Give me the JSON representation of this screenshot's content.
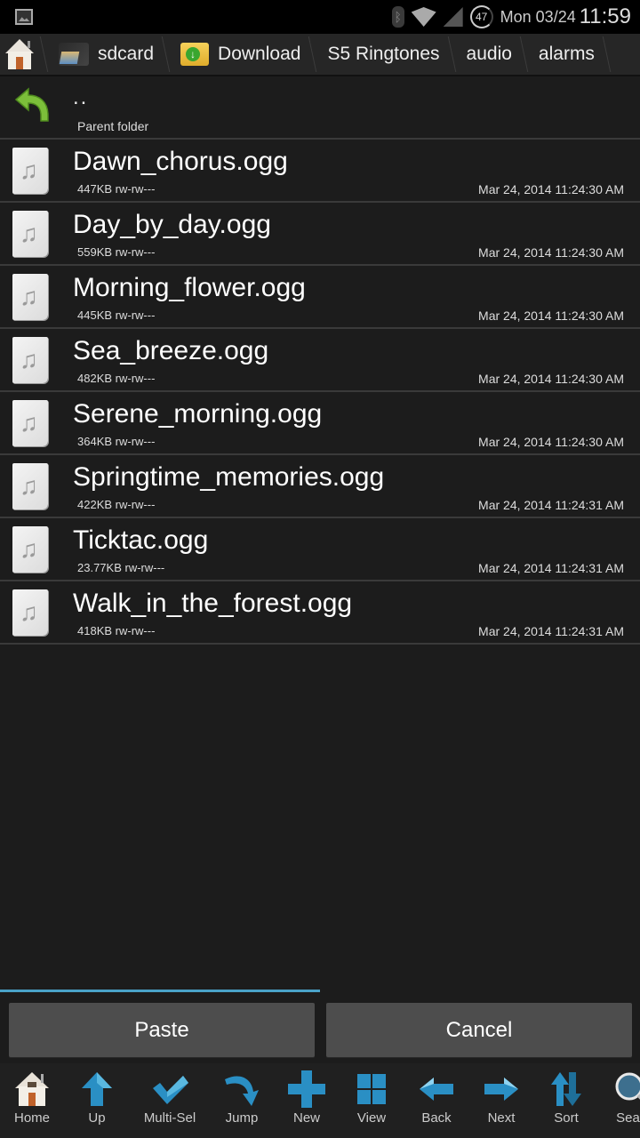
{
  "status_bar": {
    "battery": "47",
    "date": "Mon 03/24",
    "time": "11:59"
  },
  "breadcrumb": {
    "items": [
      {
        "label": "sdcard",
        "icon": "sdcard-folder-icon"
      },
      {
        "label": "Download",
        "icon": "download-folder-icon"
      },
      {
        "label": "S5 Ringtones"
      },
      {
        "label": "audio"
      },
      {
        "label": "alarms"
      }
    ]
  },
  "parent": {
    "dots": "..",
    "label": "Parent folder"
  },
  "files": [
    {
      "name": "Dawn_chorus.ogg",
      "meta": "447KB rw-rw---",
      "date": "Mar 24, 2014 11:24:30 AM"
    },
    {
      "name": "Day_by_day.ogg",
      "meta": "559KB rw-rw---",
      "date": "Mar 24, 2014 11:24:30 AM"
    },
    {
      "name": "Morning_flower.ogg",
      "meta": "445KB rw-rw---",
      "date": "Mar 24, 2014 11:24:30 AM"
    },
    {
      "name": "Sea_breeze.ogg",
      "meta": "482KB rw-rw---",
      "date": "Mar 24, 2014 11:24:30 AM"
    },
    {
      "name": "Serene_morning.ogg",
      "meta": "364KB rw-rw---",
      "date": "Mar 24, 2014 11:24:30 AM"
    },
    {
      "name": "Springtime_memories.ogg",
      "meta": "422KB rw-rw---",
      "date": "Mar 24, 2014 11:24:31 AM"
    },
    {
      "name": "Ticktac.ogg",
      "meta": "23.77KB rw-rw---",
      "date": "Mar 24, 2014 11:24:31 AM"
    },
    {
      "name": "Walk_in_the_forest.ogg",
      "meta": "418KB rw-rw---",
      "date": "Mar 24, 2014 11:24:31 AM"
    }
  ],
  "progress": {
    "fraction": 0.5,
    "color": "#4aa3c8"
  },
  "actions": {
    "paste": "Paste",
    "cancel": "Cancel"
  },
  "toolbar": {
    "items": [
      {
        "label": "Home",
        "icon": "home-icon"
      },
      {
        "label": "Up",
        "icon": "up-arrow-icon"
      },
      {
        "label": "Multi-Sel",
        "icon": "checkmark-icon"
      },
      {
        "label": "Jump",
        "icon": "jump-arrow-icon"
      },
      {
        "label": "New",
        "icon": "plus-icon"
      },
      {
        "label": "View",
        "icon": "grid-icon"
      },
      {
        "label": "Back",
        "icon": "left-arrow-icon"
      },
      {
        "label": "Next",
        "icon": "right-arrow-icon"
      },
      {
        "label": "Sort",
        "icon": "sort-icon"
      },
      {
        "label": "Sear",
        "icon": "search-icon"
      }
    ]
  },
  "colors": {
    "accent": "#4aa3c8",
    "icon_blue": "#2a8fc4",
    "background": "#1c1c1c",
    "button": "#4d4d4d"
  }
}
